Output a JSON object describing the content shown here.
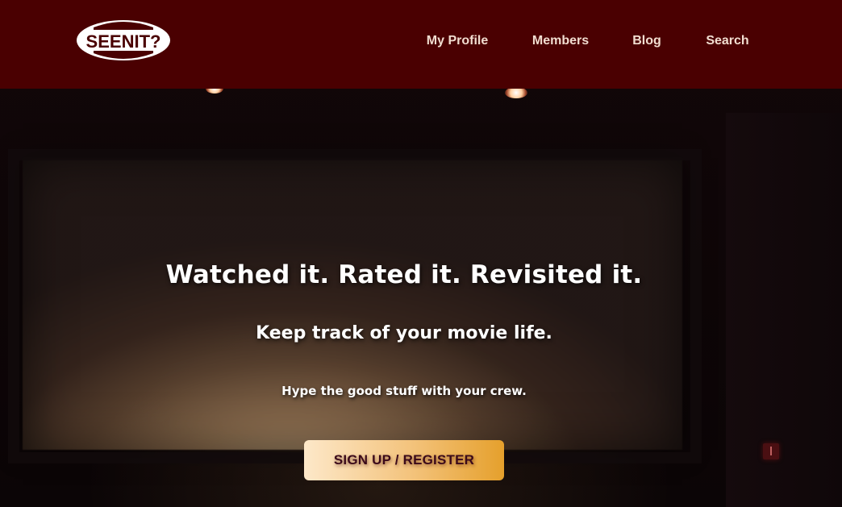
{
  "brand": {
    "logo_text": "SEENIT?"
  },
  "nav": {
    "items": [
      {
        "label": "My Profile"
      },
      {
        "label": "Members"
      },
      {
        "label": "Blog"
      },
      {
        "label": "Search"
      }
    ]
  },
  "hero": {
    "headline": "Watched it. Rated it. Revisited it.",
    "subheadline": "Keep track of your movie life.",
    "tagline": "Hype the good stuff with your crew.",
    "cta_label": "SIGN UP / REGISTER"
  },
  "colors": {
    "header_bg": "#4a0001",
    "nav_text": "#f1ddd0",
    "cta_gradient_start": "#fde8c9",
    "cta_gradient_end": "#e5a02c",
    "cta_text": "#3b0a1a"
  }
}
